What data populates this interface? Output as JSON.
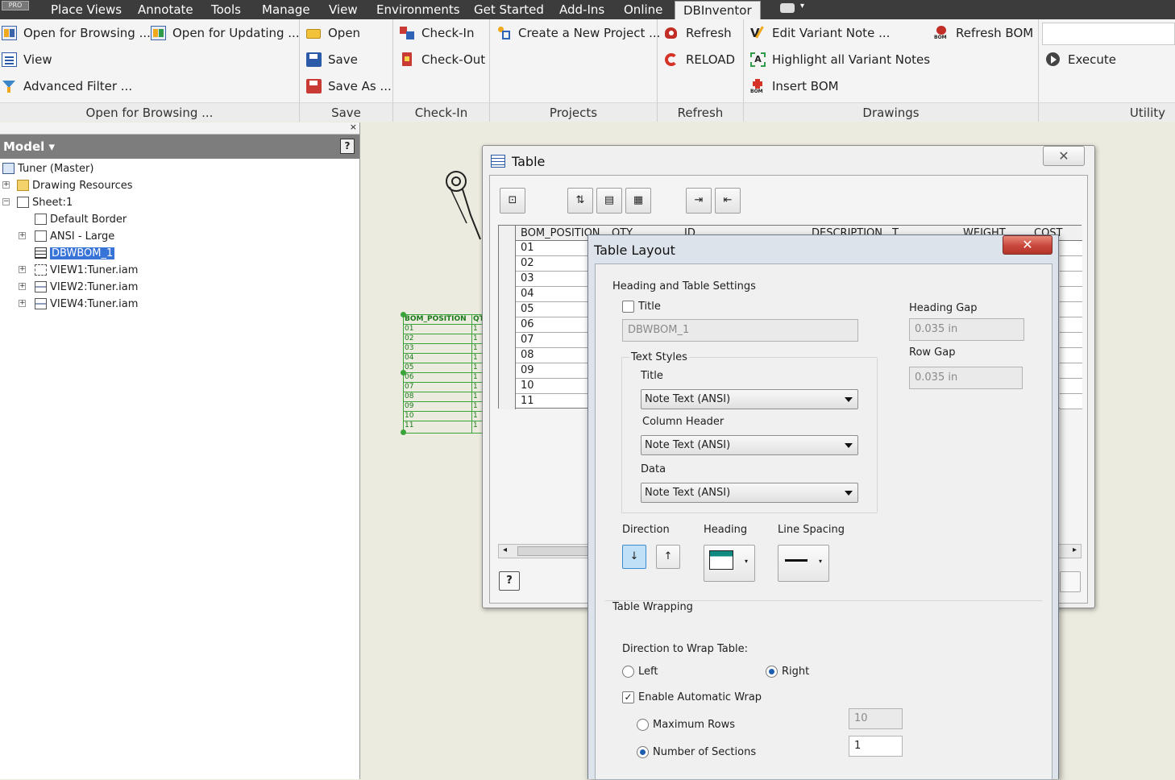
{
  "menubar": {
    "logo": "PRO",
    "tabs": [
      "Place Views",
      "Annotate",
      "Tools",
      "Manage",
      "View",
      "Environments",
      "Get Started",
      "Add-Ins",
      "Online",
      "DBInventor"
    ],
    "active_tab": "DBInventor"
  },
  "ribbon": {
    "open_for_browsing_btn": "Open for Browsing ...",
    "open_for_updating_btn": "Open for Updating ...",
    "view_btn": "View",
    "advanced_filter_btn": "Advanced Filter ...",
    "open_btn": "Open",
    "save_btn": "Save",
    "save_as_btn": "Save As ...",
    "check_in_btn": "Check-In",
    "check_out_btn": "Check-Out",
    "create_project_btn": "Create a New Project ...",
    "refresh_btn": "Refresh",
    "reload_btn": "RELOAD",
    "edit_variant_btn": "Edit Variant Note ...",
    "highlight_btn": "Highlight all Variant Notes",
    "insert_bom_btn": "Insert BOM",
    "refresh_bom_btn": "Refresh BOM",
    "execute_btn": "Execute",
    "groups": {
      "open_for_browsing": "Open for Browsing ...",
      "save": "Save",
      "check_in": "Check-In",
      "projects": "Projects",
      "refresh": "Refresh",
      "drawings": "Drawings",
      "utility": "Utility"
    }
  },
  "browser": {
    "header": "Model ▾",
    "nodes": {
      "root": "Tuner (Master)",
      "drawing_resources": "Drawing Resources",
      "sheet": "Sheet:1",
      "default_border": "Default Border",
      "ansi": "ANSI - Large",
      "dbwbom": "DBWBOM_1",
      "view1": "VIEW1:Tuner.iam",
      "view2": "VIEW2:Tuner.iam",
      "view4": "VIEW4:Tuner.iam"
    }
  },
  "sheet_table": {
    "header_pos": "BOM_POSITION",
    "header_qty": "QT",
    "rows": [
      "01",
      "02",
      "03",
      "04",
      "05",
      "06",
      "07",
      "08",
      "09",
      "10",
      "11"
    ],
    "qty": [
      "1",
      "1",
      "1",
      "1",
      "1",
      "1",
      "1",
      "1",
      "1",
      "1",
      "1"
    ]
  },
  "table_dialog": {
    "title": "Table",
    "close": "✕",
    "columns": [
      "BOM_POSITION",
      "QTY",
      "ID",
      "DESCRIPTION",
      "T",
      "WEIGHT",
      "COST"
    ],
    "rows": [
      "01",
      "02",
      "03",
      "04",
      "05",
      "06",
      "07",
      "08",
      "09",
      "10",
      "11"
    ]
  },
  "layout_dialog": {
    "title": "Table Layout",
    "close": "✕",
    "heading_section": "Heading and Table Settings",
    "title_checkbox": "Title",
    "title_value": "DBWBOM_1",
    "heading_gap_label": "Heading Gap",
    "heading_gap_value": "0.035 in",
    "row_gap_label": "Row Gap",
    "row_gap_value": "0.035 in",
    "text_styles_label": "Text Styles",
    "title_style_label": "Title",
    "title_style": "Note Text (ANSI)",
    "column_header_label": "Column Header",
    "column_header_style": "Note Text (ANSI)",
    "data_label": "Data",
    "data_style": "Note Text (ANSI)",
    "direction_label": "Direction",
    "heading_label": "Heading",
    "line_spacing_label": "Line Spacing",
    "wrap_section": "Table Wrapping",
    "wrap_direction_label": "Direction to Wrap Table:",
    "left_label": "Left",
    "right_label": "Right",
    "auto_wrap_label": "Enable Automatic Wrap",
    "max_rows_label": "Maximum Rows",
    "max_rows_value": "10",
    "sections_label": "Number of Sections",
    "sections_value": "1"
  }
}
